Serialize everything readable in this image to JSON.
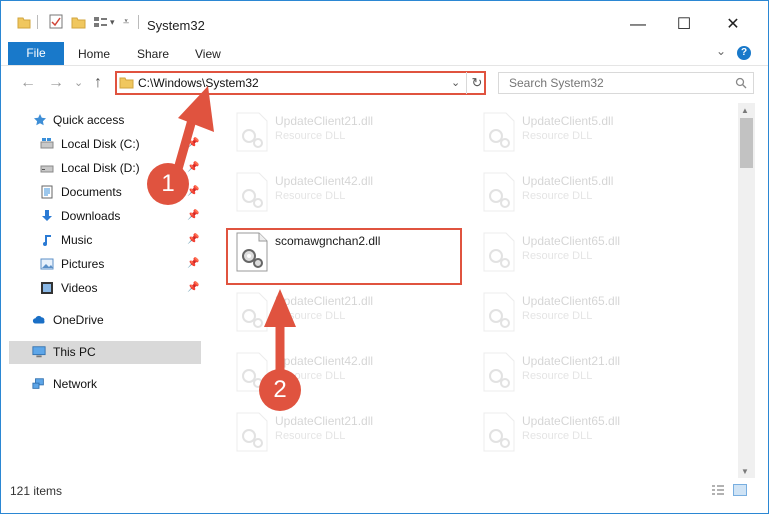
{
  "window": {
    "title": "System32",
    "minimize": "—",
    "maximize": "☐",
    "close": "✕"
  },
  "ribbon": {
    "tabs": [
      "File",
      "Home",
      "Share",
      "View"
    ],
    "expand": "⌄",
    "help": "?"
  },
  "nav": {
    "back": "←",
    "forward": "→",
    "history": "⌄",
    "up": "↑",
    "address": "C:\\Windows\\System32",
    "address_dropdown": "⌄",
    "refresh": "↻",
    "search_placeholder": "Search System32"
  },
  "sidebar": {
    "quick_access": "Quick access",
    "items": [
      {
        "label": "Local Disk (C:)",
        "icon": "drive-icon"
      },
      {
        "label": "Local Disk (D:)",
        "icon": "drive-icon"
      },
      {
        "label": "Documents",
        "icon": "documents-icon"
      },
      {
        "label": "Downloads",
        "icon": "download-icon"
      },
      {
        "label": "Music",
        "icon": "music-icon"
      },
      {
        "label": "Pictures",
        "icon": "pictures-icon"
      },
      {
        "label": "Videos",
        "icon": "videos-icon"
      }
    ],
    "onedrive": "OneDrive",
    "this_pc": "This PC",
    "network": "Network"
  },
  "files": {
    "left_column": [
      {
        "name": "UpdateClient21.dll",
        "type": "Resource DLL"
      },
      {
        "name": "UpdateClient42.dll",
        "type": "Resource DLL"
      },
      {
        "name": "scomawgnchan2.dll",
        "type": ""
      },
      {
        "name": "UpdateClient21.dll",
        "type": "Resource DLL"
      },
      {
        "name": "UpdateClient42.dll",
        "type": "Resource DLL"
      },
      {
        "name": "UpdateClient21.dll",
        "type": "Resource DLL"
      }
    ],
    "right_column": [
      {
        "name": "UpdateClient5.dll",
        "type": "Resource DLL"
      },
      {
        "name": "UpdateClient5.dll",
        "type": "Resource DLL"
      },
      {
        "name": "UpdateClient65.dll",
        "type": "Resource DLL"
      },
      {
        "name": "UpdateClient65.dll",
        "type": "Resource DLL"
      },
      {
        "name": "UpdateClient21.dll",
        "type": "Resource DLL"
      },
      {
        "name": "UpdateClient65.dll",
        "type": "Resource DLL"
      }
    ]
  },
  "status": {
    "item_count": "121 items"
  },
  "annotations": {
    "step1": "1",
    "step2": "2"
  },
  "colors": {
    "accent": "#1979ca",
    "highlight": "#e0533f",
    "selection": "#d9d9d9"
  }
}
